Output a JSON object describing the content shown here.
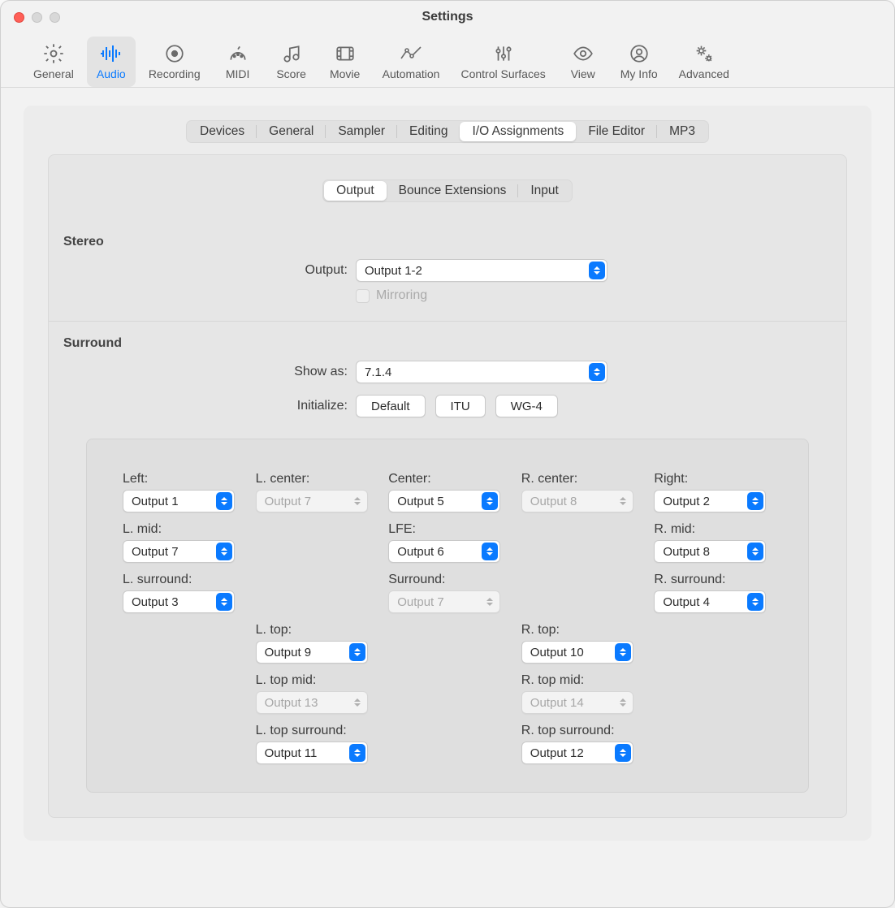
{
  "window": {
    "title": "Settings"
  },
  "toolbar": [
    {
      "id": "general",
      "label": "General"
    },
    {
      "id": "audio",
      "label": "Audio"
    },
    {
      "id": "recording",
      "label": "Recording"
    },
    {
      "id": "midi",
      "label": "MIDI"
    },
    {
      "id": "score",
      "label": "Score"
    },
    {
      "id": "movie",
      "label": "Movie"
    },
    {
      "id": "automation",
      "label": "Automation"
    },
    {
      "id": "control-surfaces",
      "label": "Control Surfaces"
    },
    {
      "id": "view",
      "label": "View"
    },
    {
      "id": "my-info",
      "label": "My Info"
    },
    {
      "id": "advanced",
      "label": "Advanced"
    }
  ],
  "tabs1": [
    "Devices",
    "General",
    "Sampler",
    "Editing",
    "I/O Assignments",
    "File Editor",
    "MP3"
  ],
  "tabs1_selected": 4,
  "tabs2": [
    "Output",
    "Bounce Extensions",
    "Input"
  ],
  "tabs2_selected": 0,
  "stereo": {
    "title": "Stereo",
    "output_label": "Output:",
    "output_value": "Output 1-2",
    "mirroring_label": "Mirroring"
  },
  "surround": {
    "title": "Surround",
    "showas_label": "Show as:",
    "showas_value": "7.1.4",
    "init_label": "Initialize:",
    "init_buttons": [
      "Default",
      "ITU",
      "WG-4"
    ]
  },
  "channels": [
    [
      {
        "label": "Left:",
        "value": "Output 1",
        "enabled": true
      },
      {
        "label": "L. center:",
        "value": "Output 7",
        "enabled": false
      },
      {
        "label": "Center:",
        "value": "Output 5",
        "enabled": true
      },
      {
        "label": "R. center:",
        "value": "Output 8",
        "enabled": false
      },
      {
        "label": "Right:",
        "value": "Output 2",
        "enabled": true
      }
    ],
    [
      {
        "label": "L. mid:",
        "value": "Output 7",
        "enabled": true
      },
      null,
      {
        "label": "LFE:",
        "value": "Output 6",
        "enabled": true
      },
      null,
      {
        "label": "R. mid:",
        "value": "Output 8",
        "enabled": true
      }
    ],
    [
      {
        "label": "L. surround:",
        "value": "Output 3",
        "enabled": true
      },
      null,
      {
        "label": "Surround:",
        "value": "Output 7",
        "enabled": false
      },
      null,
      {
        "label": "R. surround:",
        "value": "Output 4",
        "enabled": true
      }
    ],
    [
      null,
      {
        "label": "L. top:",
        "value": "Output 9",
        "enabled": true
      },
      null,
      {
        "label": "R. top:",
        "value": "Output 10",
        "enabled": true
      },
      null
    ],
    [
      null,
      {
        "label": "L. top mid:",
        "value": "Output 13",
        "enabled": false
      },
      null,
      {
        "label": "R. top mid:",
        "value": "Output 14",
        "enabled": false
      },
      null
    ],
    [
      null,
      {
        "label": "L. top surround:",
        "value": "Output 11",
        "enabled": true
      },
      null,
      {
        "label": "R. top surround:",
        "value": "Output 12",
        "enabled": true
      },
      null
    ]
  ]
}
